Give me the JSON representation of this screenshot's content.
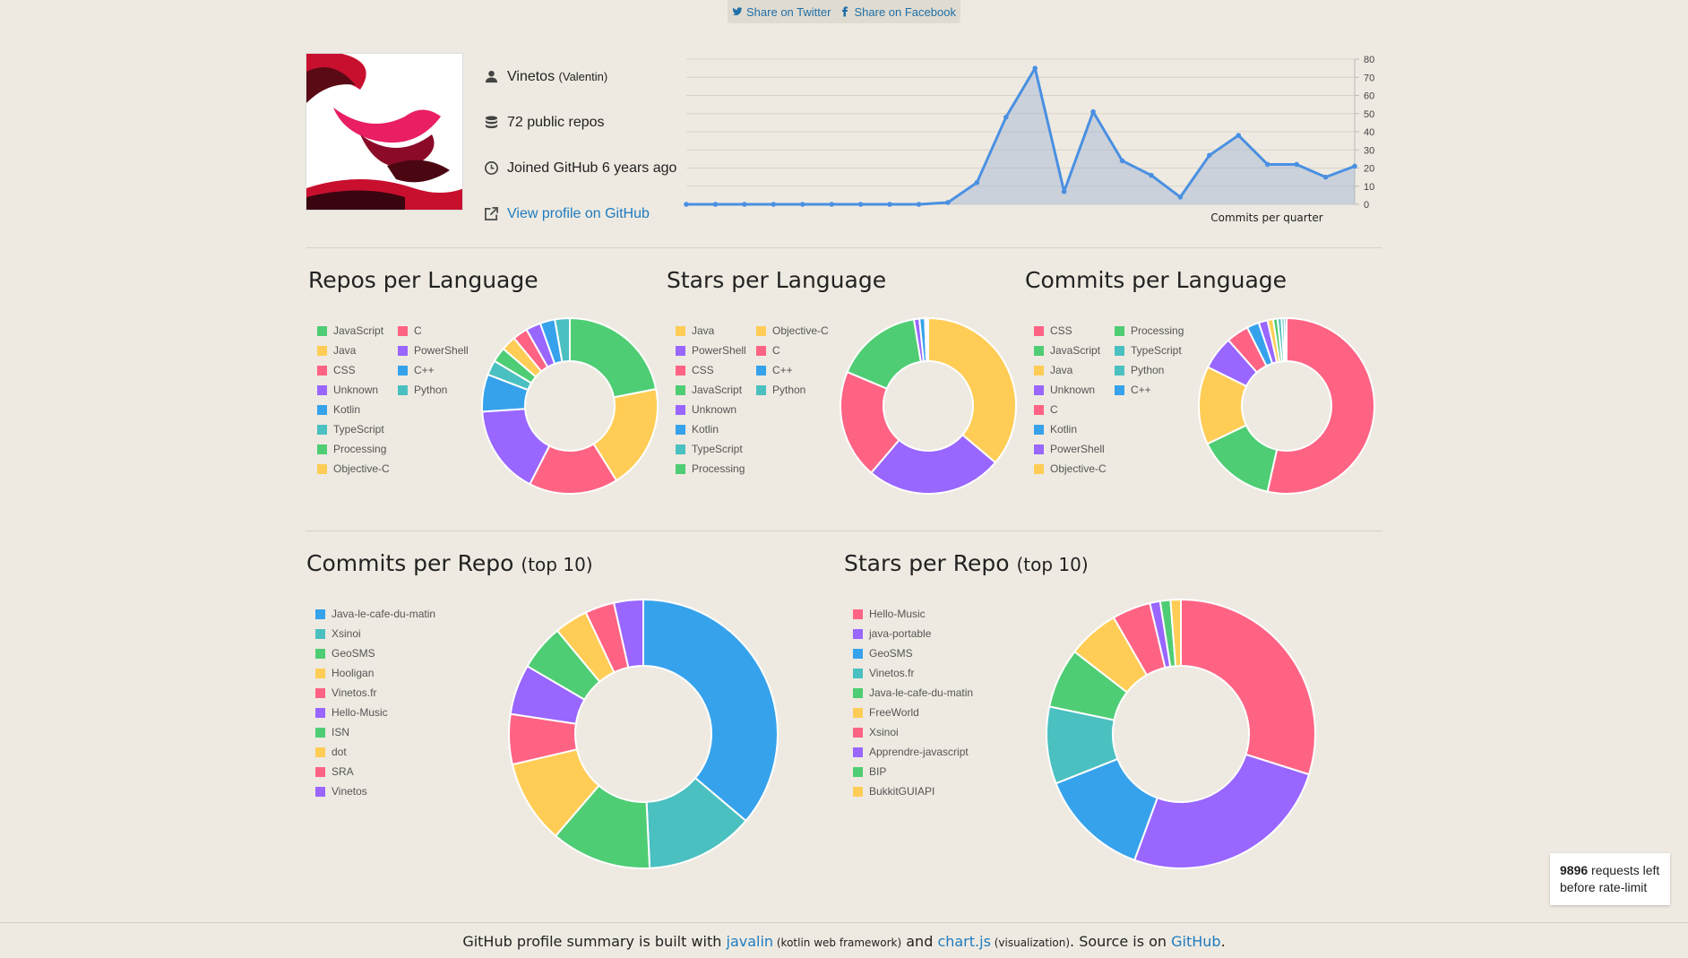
{
  "share": {
    "twitter": "Share on Twitter",
    "facebook": "Share on Facebook"
  },
  "profile": {
    "username": "Vinetos",
    "realname": "(Valentin)",
    "repos": "72 public repos",
    "joined": "Joined GitHub 6 years ago",
    "view_link": "View profile on GitHub"
  },
  "sections": {
    "repos_per_language": "Repos per Language",
    "stars_per_language": "Stars per Language",
    "commits_per_language": "Commits per Language",
    "commits_per_repo": "Commits per Repo",
    "stars_per_repo": "Stars per Repo",
    "top10": "(top 10)"
  },
  "rate_limit": {
    "count": "9896",
    "text1": " requests left",
    "text2": "before rate-limit"
  },
  "footer": {
    "t1": "GitHub profile summary is built with ",
    "javalin": "javalin",
    "t2": " (kotlin web framework)",
    "t3": " and ",
    "chartjs": "chart.js",
    "t4": " (visualization)",
    "t5": ". Source is on ",
    "github": "GitHub",
    "t6": "."
  },
  "colors": {
    "blue": "#36a2eb",
    "teal": "#4bc0c0",
    "green": "#4fcd74",
    "yellow": "#ffcd56",
    "red": "#ff6384",
    "purple": "#9966ff",
    "line": "#4a90e2"
  },
  "chart_data": [
    {
      "id": "commits-per-quarter",
      "type": "area",
      "xlabel": "Commits per quarter",
      "ylim": [
        0,
        80
      ],
      "yticks": [
        0,
        10,
        20,
        30,
        40,
        50,
        60,
        70,
        80
      ],
      "values": [
        0,
        0,
        0,
        0,
        0,
        0,
        0,
        0,
        0,
        1,
        12,
        48,
        75,
        7,
        51,
        24,
        16,
        4,
        27,
        38,
        22,
        22,
        15,
        21
      ],
      "grid": true
    },
    {
      "id": "repos-per-language",
      "type": "pie",
      "labels": [
        "JavaScript",
        "Java",
        "CSS",
        "Unknown",
        "Kotlin",
        "TypeScript",
        "Processing",
        "Objective-C",
        "C",
        "PowerShell",
        "C++",
        "Python"
      ],
      "colors": [
        "#4fcd74",
        "#ffcd56",
        "#ff6384",
        "#9966ff",
        "#36a2eb",
        "#4bc0c0",
        "#4fcd74",
        "#ffcd56",
        "#ff6384",
        "#9966ff",
        "#36a2eb",
        "#4bc0c0"
      ],
      "values": [
        16,
        14,
        12,
        12,
        5,
        2,
        2,
        2,
        2,
        2,
        2,
        2
      ]
    },
    {
      "id": "stars-per-language",
      "type": "pie",
      "labels": [
        "Java",
        "PowerShell",
        "CSS",
        "JavaScript",
        "Unknown",
        "Kotlin",
        "TypeScript",
        "Processing",
        "Objective-C",
        "C",
        "C++",
        "Python"
      ],
      "colors": [
        "#ffcd56",
        "#9966ff",
        "#ff6384",
        "#4fcd74",
        "#9966ff",
        "#36a2eb",
        "#4bc0c0",
        "#4fcd74",
        "#ffcd56",
        "#ff6384",
        "#36a2eb",
        "#4bc0c0"
      ],
      "values": [
        36,
        25,
        20,
        16,
        1,
        1,
        0.1,
        0.1,
        0.1,
        0.1,
        0.1,
        0.1
      ]
    },
    {
      "id": "commits-per-language",
      "type": "pie",
      "labels": [
        "CSS",
        "JavaScript",
        "Java",
        "Unknown",
        "C",
        "Kotlin",
        "PowerShell",
        "Objective-C",
        "Processing",
        "TypeScript",
        "Python",
        "C++"
      ],
      "colors": [
        "#ff6384",
        "#4fcd74",
        "#ffcd56",
        "#9966ff",
        "#ff6384",
        "#36a2eb",
        "#9966ff",
        "#ffcd56",
        "#4fcd74",
        "#4bc0c0",
        "#4bc0c0",
        "#36a2eb"
      ],
      "values": [
        52,
        14,
        14,
        6,
        4,
        2.2,
        1.6,
        1,
        0.8,
        0.7,
        0.5,
        0.4
      ]
    },
    {
      "id": "commits-per-repo",
      "type": "pie",
      "labels": [
        "Java-le-cafe-du-matin",
        "Xsinoi",
        "GeoSMS",
        "Hooligan",
        "Vinetos.fr",
        "Hello-Music",
        "ISN",
        "dot",
        "SRA",
        "Vinetos"
      ],
      "colors": [
        "#36a2eb",
        "#4bc0c0",
        "#4fcd74",
        "#ffcd56",
        "#ff6384",
        "#9966ff",
        "#4fcd74",
        "#ffcd56",
        "#ff6384",
        "#9966ff"
      ],
      "values": [
        36,
        13,
        12,
        10,
        6,
        6,
        5.5,
        4,
        3.5,
        3.5
      ]
    },
    {
      "id": "stars-per-repo",
      "type": "pie",
      "labels": [
        "Hello-Music",
        "java-portable",
        "GeoSMS",
        "Vinetos.fr",
        "Java-le-cafe-du-matin",
        "FreeWorld",
        "Xsinoi",
        "Apprendre-javascript",
        "BIP",
        "BukkitGUIAPI"
      ],
      "colors": [
        "#ff6384",
        "#9966ff",
        "#36a2eb",
        "#4bc0c0",
        "#4fcd74",
        "#ffcd56",
        "#ff6384",
        "#9966ff",
        "#4fcd74",
        "#ffcd56"
      ],
      "values": [
        29,
        25,
        13,
        9,
        7,
        6,
        4.5,
        1.2,
        1.2,
        1.2
      ]
    }
  ]
}
